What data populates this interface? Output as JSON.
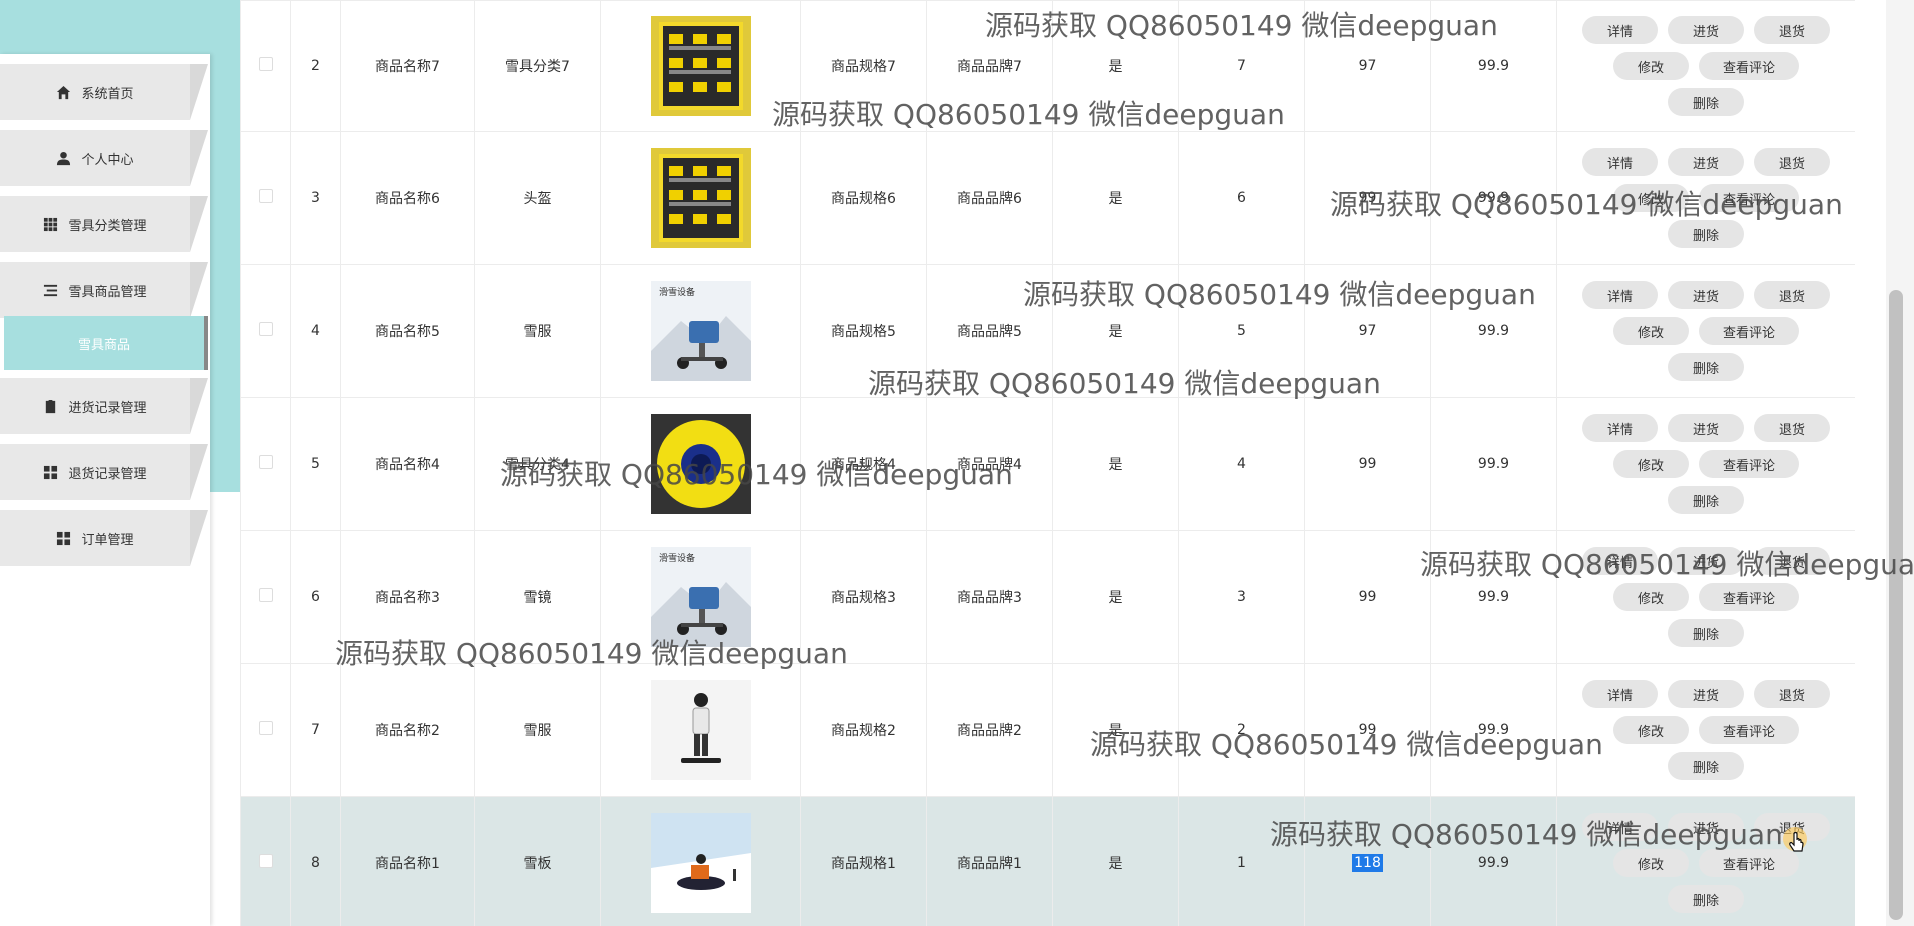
{
  "sidebar": {
    "items": [
      {
        "label": "系统首页",
        "icon": "home-icon"
      },
      {
        "label": "个人中心",
        "icon": "user-icon"
      },
      {
        "label": "雪具分类管理",
        "icon": "grid-icon"
      },
      {
        "label": "雪具商品管理",
        "icon": "list-icon"
      },
      {
        "label": "进货记录管理",
        "icon": "clipboard-icon"
      },
      {
        "label": "退货记录管理",
        "icon": "apps-icon"
      },
      {
        "label": "订单管理",
        "icon": "apps-icon"
      }
    ],
    "submenu": {
      "label": "雪具商品"
    }
  },
  "table": {
    "rows": [
      {
        "index": "2",
        "name": "商品名称7",
        "category": "雪具分类7",
        "image": "ski-boots-rack",
        "spec": "商品规格7",
        "brand": "商品品牌7",
        "flag": "是",
        "count": "7",
        "stock": "97",
        "price": "99.9"
      },
      {
        "index": "3",
        "name": "商品名称6",
        "category": "头盔",
        "image": "ski-boots-rack",
        "spec": "商品规格6",
        "brand": "商品品牌6",
        "flag": "是",
        "count": "6",
        "stock": "99",
        "price": "99.9"
      },
      {
        "index": "4",
        "name": "商品名称5",
        "category": "雪服",
        "image": "snow-machine",
        "spec": "商品规格5",
        "brand": "商品品牌5",
        "flag": "是",
        "count": "5",
        "stock": "97",
        "price": "99.9"
      },
      {
        "index": "5",
        "name": "商品名称4",
        "category": "雪具分类4",
        "image": "snow-tube",
        "spec": "商品规格4",
        "brand": "商品品牌4",
        "flag": "是",
        "count": "4",
        "stock": "99",
        "price": "99.9"
      },
      {
        "index": "6",
        "name": "商品名称3",
        "category": "雪镜",
        "image": "snow-machine",
        "spec": "商品规格3",
        "brand": "商品品牌3",
        "flag": "是",
        "count": "3",
        "stock": "99",
        "price": "99.9"
      },
      {
        "index": "7",
        "name": "商品名称2",
        "category": "雪服",
        "image": "snowboarder",
        "spec": "商品规格2",
        "brand": "商品品牌2",
        "flag": "是",
        "count": "2",
        "stock": "99",
        "price": "99.9"
      },
      {
        "index": "8",
        "name": "商品名称1",
        "category": "雪板",
        "image": "snow-scooter",
        "spec": "商品规格1",
        "brand": "商品品牌1",
        "flag": "是",
        "count": "1",
        "stock": "118",
        "price": "99.9"
      }
    ],
    "actions": {
      "detail": "详情",
      "restock": "进货",
      "return": "退货",
      "edit": "修改",
      "reviews": "查看评论",
      "delete": "删除"
    }
  },
  "watermark": "源码获取 QQ86050149 微信deepguan",
  "colors": {
    "teal": "#a7dfdf",
    "button_bg": "#e5e5e5",
    "row_highlight": "#dbe6e6",
    "selection": "#1f7ae8"
  }
}
